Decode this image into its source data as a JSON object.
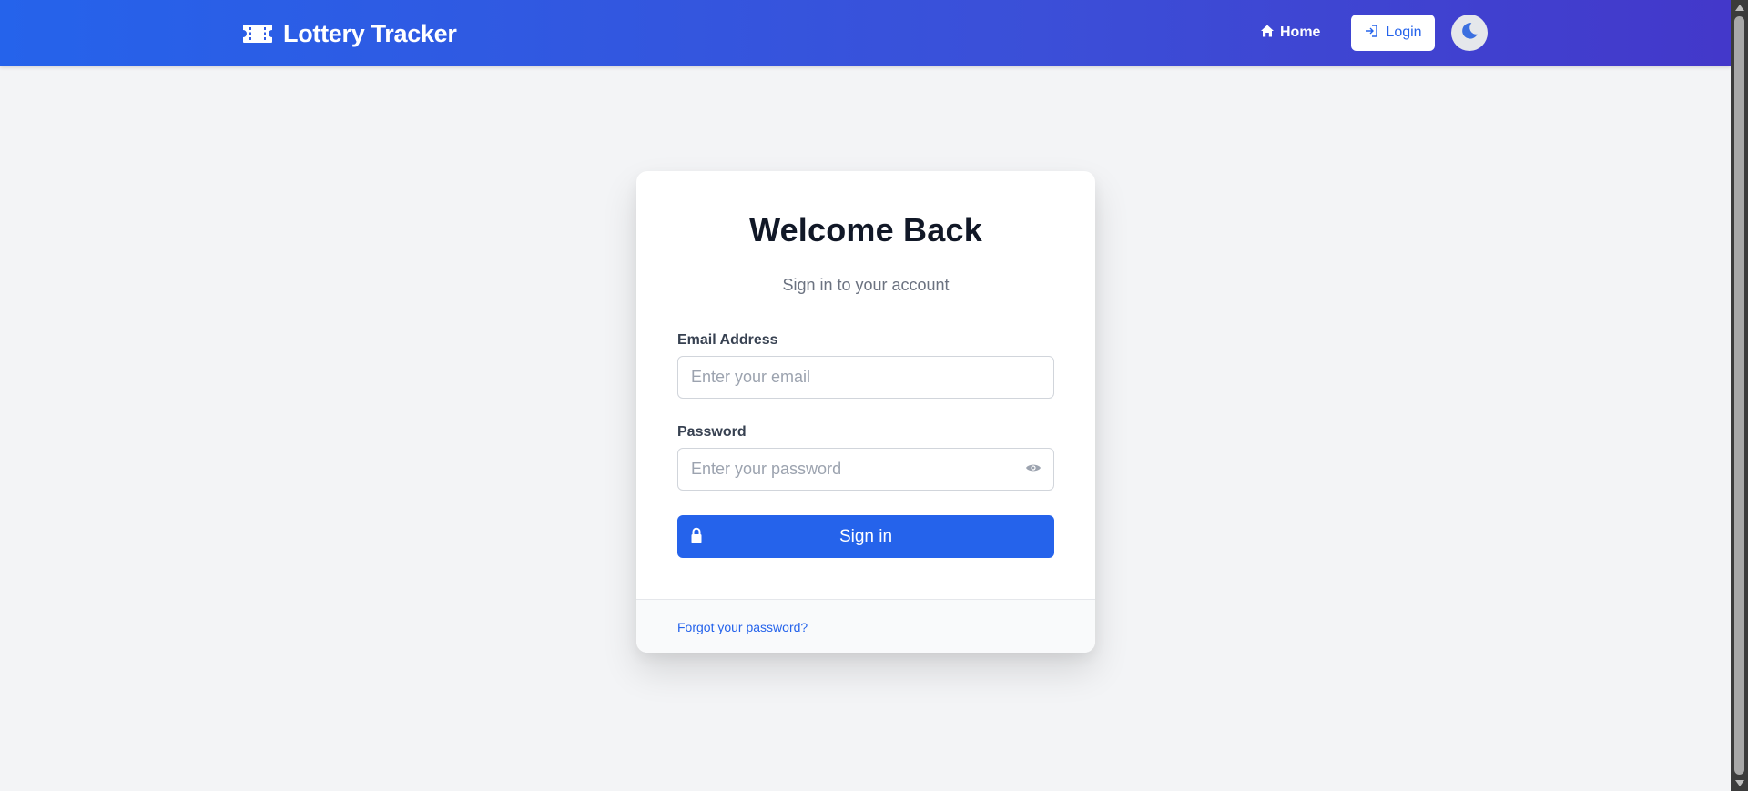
{
  "navbar": {
    "brand_icon": "ticket-icon",
    "brand": "Lottery Tracker",
    "home_icon": "home-icon",
    "home_label": "Home",
    "login_icon": "sign-in-icon",
    "login_label": "Login",
    "theme_icon": "moon-icon"
  },
  "card": {
    "title": "Welcome Back",
    "subtitle": "Sign in to your account",
    "email": {
      "label": "Email Address",
      "placeholder": "Enter your email",
      "value": ""
    },
    "password": {
      "label": "Password",
      "placeholder": "Enter your password",
      "value": "",
      "toggle_icon": "eye-icon"
    },
    "submit": {
      "icon": "lock-icon",
      "label": "Sign in"
    },
    "footer": {
      "forgot_link": "Forgot your password?"
    }
  },
  "colors": {
    "accent": "#2563eb",
    "navbar_gradient_start": "#2563eb",
    "navbar_gradient_end": "#4338ca",
    "page_background": "#f3f4f6",
    "title_text": "#111827",
    "muted_text": "#6b7280"
  }
}
